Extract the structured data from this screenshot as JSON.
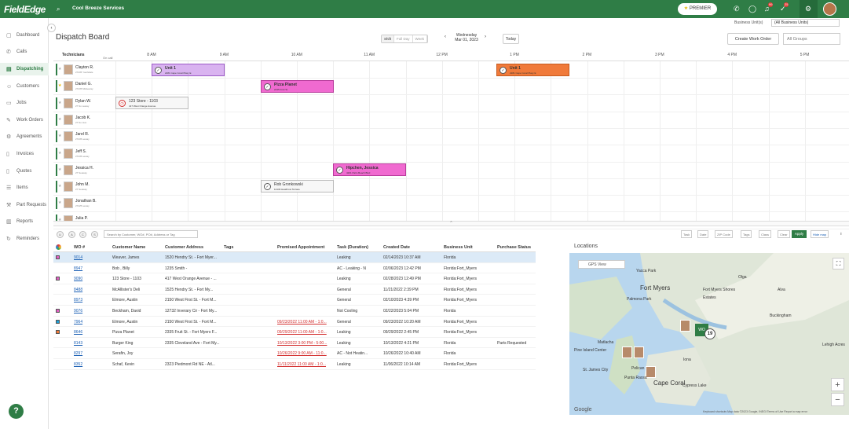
{
  "header": {
    "logo": "FieldEdge",
    "company": "Cool Breeze Services",
    "premier_label": "PREMIER",
    "notifications_badge": "99",
    "messages_badge": "25"
  },
  "sidebar": {
    "items": [
      {
        "label": "Dashboard",
        "icon": "dashboard-icon",
        "glyph": "▢"
      },
      {
        "label": "Calls",
        "icon": "phone-icon",
        "glyph": "✆"
      },
      {
        "label": "Dispatching",
        "icon": "dispatch-icon",
        "glyph": "▤"
      },
      {
        "label": "Customers",
        "icon": "customers-icon",
        "glyph": "☺"
      },
      {
        "label": "Jobs",
        "icon": "jobs-icon",
        "glyph": "▭"
      },
      {
        "label": "Work Orders",
        "icon": "work-orders-icon",
        "glyph": "✎"
      },
      {
        "label": "Agreements",
        "icon": "agreements-icon",
        "glyph": "⚙"
      },
      {
        "label": "Invoices",
        "icon": "invoices-icon",
        "glyph": "▯"
      },
      {
        "label": "Quotes",
        "icon": "quotes-icon",
        "glyph": "▯"
      },
      {
        "label": "Items",
        "icon": "items-icon",
        "glyph": "☰"
      },
      {
        "label": "Part Requests",
        "icon": "part-requests-icon",
        "glyph": "⚒"
      },
      {
        "label": "Reports",
        "icon": "reports-icon",
        "glyph": "▥"
      },
      {
        "label": "Reminders",
        "icon": "reminders-icon",
        "glyph": "↻"
      }
    ],
    "active": "Dispatching"
  },
  "page": {
    "title": "Dispatch Board",
    "business_unit_label": "Business Unit(s)",
    "business_unit_value": "(All Business Units)",
    "views": [
      "Shift",
      "Full Day",
      "Week"
    ],
    "date_weekday": "Wednesday",
    "date": "Mar 01, 2023",
    "today_label": "Today",
    "create_work_order": "Create Work Order",
    "groups_placeholder": "All Groups"
  },
  "board": {
    "technicians_header": "Technicians",
    "on_call_label": "On call",
    "hours": [
      "8 AM",
      "9 AM",
      "10 AM",
      "11 AM",
      "12 PM",
      "1 PM",
      "2 PM",
      "3 PM",
      "4 PM",
      "5 PM"
    ],
    "technicians": [
      {
        "name": "Clayton R.",
        "sub": "27235 Youthdale",
        "star": false
      },
      {
        "name": "Daniel G.",
        "sub": "27235 Midseway",
        "star": true
      },
      {
        "name": "Dylan W.",
        "sub": "27 No seway",
        "star": false
      },
      {
        "name": "Jacob K.",
        "sub": "27 No Hun",
        "star": false
      },
      {
        "name": "Jarel R.",
        "sub": "27235 seway",
        "star": false
      },
      {
        "name": "Jeff S.",
        "sub": "27235 seway",
        "star": false
      },
      {
        "name": "Jessica H.",
        "sub": "27 Seaway",
        "star": false
      },
      {
        "name": "John M.",
        "sub": "27 Seaway",
        "star": false
      },
      {
        "name": "Jonathan B.",
        "sub": "27225 seway",
        "star": false
      },
      {
        "name": "Julia P.",
        "sub": "",
        "star": false
      }
    ],
    "jobs": [
      {
        "title": "Unit 1",
        "sub": "2281 Cape Coral Pkwy E",
        "color": "#d9b3f0",
        "border": "#9b59c6"
      },
      {
        "title": "Unit 1",
        "sub": "2281 Cape Coral Pkwy E",
        "color": "#f07a3a",
        "border": "#c55a1f"
      },
      {
        "title": "Pizza Planet",
        "sub": "2235 Fruit St",
        "color": "#f06ad0",
        "border": "#b83b9c"
      },
      {
        "title": "123 Store - 1103",
        "sub": "417 West Orange Avenue",
        "color": "#f7f7f7",
        "border": "#bbb"
      },
      {
        "title": "Hipchen, Jessica",
        "sub": "4201 Palm Beach Blvd",
        "color": "#f06ad0",
        "border": "#b83b9c"
      },
      {
        "title": "Rob Gronkowski",
        "sub": "12133 Heathrow Terrace",
        "color": "#f7f7f7",
        "border": "#bbb"
      }
    ]
  },
  "toolbar": {
    "circles": [
      "U",
      "A",
      "C",
      "S"
    ],
    "search_placeholder": "Search by Customer, WO#, PO#, Address or Tag",
    "filters": [
      "Task",
      "Date",
      "ZIP Code",
      "Tags",
      "Class"
    ],
    "clear_label": "Clear",
    "apply_label": "Apply",
    "hide_map_label": "Hide map"
  },
  "table": {
    "columns": [
      "WO #",
      "Customer Name",
      "Customer Address",
      "Tags",
      "Promised Appointment",
      "Task (Duration)",
      "Created Date",
      "Business Unit",
      "Purchase Status"
    ],
    "rows": [
      {
        "swatch": "#e05fc2",
        "wo": "9014",
        "customer": "Weaver, James",
        "address": "1520 Hendry St. - Fort Myer...",
        "tags": "",
        "promised": "",
        "task": "Leaking",
        "created": "02/14/2023 10:37 AM",
        "bu": "Florida",
        "purchase": "",
        "selected": true
      },
      {
        "swatch": "",
        "wo": "8947",
        "customer": "Bob , Billy",
        "address": "1235 Smith -",
        "tags": "",
        "promised": "",
        "task": "AC - Leaking - N",
        "created": "02/06/2023 12:42 PM",
        "bu": "Florida:Fort_Myers",
        "purchase": "",
        "selected": false
      },
      {
        "swatch": "#e05fc2",
        "wo": "9090",
        "customer": "123 Store - 1103",
        "address": "417 West Orange Avenue - ...",
        "tags": "",
        "promised": "",
        "task": "Leaking",
        "created": "02/28/2023 12:49 PM",
        "bu": "Florida:Fort_Myers",
        "purchase": "",
        "selected": false
      },
      {
        "swatch": "",
        "wo": "8488",
        "customer": "McAllister's Deli",
        "address": "1525 Hendry St. - Fort My...",
        "tags": "",
        "promised": "",
        "task": "General",
        "created": "11/21/2022 2:39 PM",
        "bu": "Florida:Fort_Myers",
        "purchase": "",
        "selected": false
      },
      {
        "swatch": "",
        "wo": "8973",
        "customer": "Elmore, Austin",
        "address": "2150 West First St. - Fort M...",
        "tags": "",
        "promised": "",
        "task": "General",
        "created": "02/10/2023 4:39 PM",
        "bu": "Florida:Fort_Myers",
        "purchase": "",
        "selected": false
      },
      {
        "swatch": "#e05fc2",
        "wo": "9076",
        "customer": "Beckham, David",
        "address": "12732 Inverary Cir - Fort My...",
        "tags": "",
        "promised": "",
        "task": "Not Cooling",
        "created": "02/22/2023 5:04 PM",
        "bu": "Florida",
        "purchase": "",
        "selected": false
      },
      {
        "swatch": "#1f9fd6",
        "wo": "7964",
        "customer": "Elmore, Austin",
        "address": "2150 West First St. - Fort M...",
        "tags": "",
        "promised": "09/23/2022 11:00 AM - 1:0...",
        "task": "General",
        "created": "09/23/2022 10:20 AM",
        "bu": "Florida:Fort_Myers",
        "purchase": "",
        "selected": false
      },
      {
        "swatch": "#f07a3a",
        "wo": "8646",
        "customer": "Pizza Planet",
        "address": "2335 Fruit St. - Fort Myers F...",
        "tags": "",
        "promised": "09/29/2022 11:00 AM - 1:0...",
        "task": "Leaking",
        "created": "09/29/2022 2:45 PM",
        "bu": "Florida:Fort_Myers",
        "purchase": "",
        "selected": false
      },
      {
        "swatch": "",
        "wo": "8143",
        "customer": "Burger King",
        "address": "2335 Cleveland Ave - Fort My...",
        "tags": "",
        "promised": "10/13/2022 3:00 PM - 5:00...",
        "task": "Leaking",
        "created": "10/13/2022 4:21 PM",
        "bu": "Florida",
        "purchase": "Parts Requested",
        "selected": false
      },
      {
        "swatch": "",
        "wo": "8297",
        "customer": "Serafin, Joy",
        "address": "",
        "tags": "",
        "promised": "10/26/2022 9:00 AM - 11:0...",
        "task": "AC - Not Heatin...",
        "created": "10/26/2022 10:40 AM",
        "bu": "Florida",
        "purchase": "",
        "selected": false
      },
      {
        "swatch": "",
        "wo": "8352",
        "customer": "Schaf, Kevin",
        "address": "2323 Piedmont Rd NE - Atl...",
        "tags": "",
        "promised": "11/11/2022 11:00 AM - 1:0...",
        "task": "Leaking",
        "created": "11/06/2022 10:14 AM",
        "bu": "Florida:Fort_Myers",
        "purchase": "",
        "selected": false
      }
    ]
  },
  "map": {
    "title": "Locations",
    "gps_label": "GPS View",
    "cluster_count": "19",
    "labels": [
      "Yacca Park",
      "Fort Myers",
      "Fort Myers Shores",
      "Olga",
      "Alva",
      "Estates",
      "Buckingham",
      "Palmona Park",
      "Lehigh Acres",
      "Cape Coral",
      "Pine Island Center",
      "Matlacha",
      "St. James City",
      "Pelican",
      "Punta Rassa",
      "Iona",
      "Cypress Lake"
    ],
    "footer": "Keyboard shortcuts   Map data ©2023 Google, INEGI   Terms of Use   Report a map error",
    "google": "Google"
  }
}
